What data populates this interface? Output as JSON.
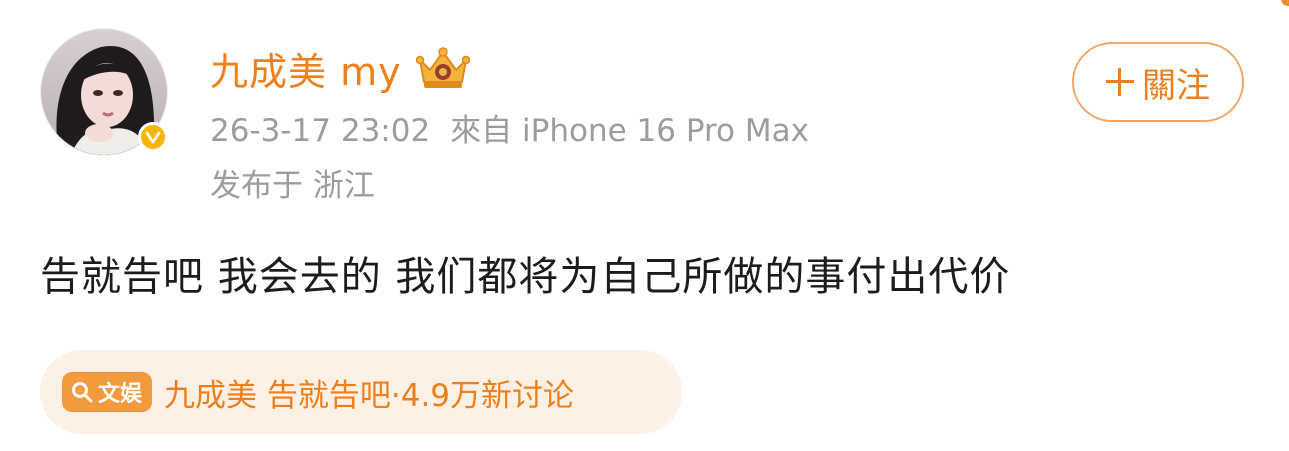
{
  "post": {
    "username": "九成美 my",
    "timestamp": "26-3-17 23:02",
    "source": "來自 iPhone 16 Pro Max",
    "location": "发布于 浙江",
    "follow_label": "關注",
    "content": "告就告吧 我会去的 我们都将为自己所做的事付出代价"
  },
  "topic": {
    "tag_label": "文娱",
    "title": "九成美 告就告吧",
    "stats": "·4.9万新讨论"
  },
  "colors": {
    "accent": "#ef7f1a",
    "meta_text": "#9c9c9c",
    "body_text": "#1c1c1c",
    "chip_bg": "#fdf1e6",
    "badge": "#f7b500"
  },
  "icons": {
    "crown": "crown-icon",
    "verified": "verified-badge-icon",
    "plus": "plus-icon",
    "search": "search-icon"
  }
}
